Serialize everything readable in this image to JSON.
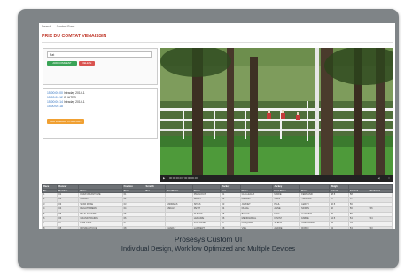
{
  "nav": {
    "items": [
      "Search",
      "Contact Form"
    ]
  },
  "page_title": "PRIX DU COMTAT VENAISSIN",
  "filter": {
    "input_value": "Fat"
  },
  "buttons": {
    "add_comment": "ADD COMMENT",
    "delete": "DELETE",
    "add_remark": "ADD REMARK TO REPORT"
  },
  "log": {
    "entries": [
      {
        "time": "15:00:00.00",
        "text": "Intraday 2014-1"
      },
      {
        "time": "15:00:00.12",
        "text": "CHUTES"
      },
      {
        "time": "15:00:00.14",
        "text": "Intraday 2014-1"
      },
      {
        "time": "15:00:00.18",
        "text": ""
      }
    ]
  },
  "video": {
    "time_label": "00:00:00.00 / 00:00:00.00"
  },
  "table": {
    "group_headers": [
      "Race",
      "Runner",
      "",
      "Fraction",
      "Scratch",
      "",
      "",
      "Jockey",
      "",
      "Jockey",
      "",
      "Weight",
      "",
      ""
    ],
    "headers": [
      "No",
      "Number",
      "Name",
      "Start",
      "Pos",
      "First Name",
      "Name",
      "Hat",
      "Name",
      "First Name",
      "Name",
      "Actual",
      "Carried",
      "Declared"
    ],
    "rows": [
      [
        "1",
        "01",
        "KADAYA FANTOME",
        "01",
        "",
        "",
        "PIERLOUIS",
        "01",
        "GUILLEAUX",
        "MARIE",
        "FERNAND",
        "58.5",
        "58",
        ""
      ],
      [
        "2",
        "02",
        "CALMO",
        "02",
        "",
        "",
        "BAILLY",
        "02",
        "PERRIN",
        "JEAN",
        "THOMAS",
        "57",
        "57",
        ""
      ],
      [
        "3",
        "03",
        "STAR ROSE",
        "03",
        "",
        "ANDREAS",
        "SPIES",
        "03",
        "JARNET",
        "PAUL",
        "LEROY",
        "56.5",
        "56",
        ""
      ],
      [
        "4",
        "04",
        "REGATTABERG",
        "04",
        "",
        "ASDALT",
        "PETIT",
        "04",
        "DUVAL",
        "ANNE",
        "MORIN",
        "56",
        "56",
        "56"
      ],
      [
        "5",
        "05",
        "BLUE DANUBE",
        "05",
        "",
        "",
        "DUBOIS",
        "05",
        "BOEUF",
        "ERIC",
        "GARNIER",
        "55",
        "55",
        ""
      ],
      [
        "6",
        "06",
        "GRAND PRAIRIE",
        "06",
        "",
        "",
        "LEMAIRE",
        "06",
        "MENDIZABAL",
        "IONITZ",
        "FABRE",
        "54.5",
        "54",
        "54"
      ],
      [
        "7",
        "07",
        "FIRE KING",
        "07",
        "",
        "",
        "FONTAINE",
        "07",
        "PASQUIER",
        "STEPH",
        "CHEVALIER",
        "54",
        "54",
        ""
      ],
      [
        "8",
        "08",
        "ROSMANTIQUE",
        "08",
        "",
        "CHARLY",
        "LAMBERT",
        "08",
        "VIEL",
        "ANDRE",
        "ROBIN",
        "53",
        "53",
        "53"
      ]
    ]
  },
  "caption": {
    "line1": "Prosesys Custom UI",
    "line2": "Individual Design, Workflow Optimized and Multiple Devices"
  },
  "colors": {
    "frame": "#7f8487",
    "title_red": "#c0392b",
    "button_green": "#3aa457",
    "button_red": "#d9534f",
    "button_orange": "#f0a032",
    "table_header": "#6d7175"
  },
  "icons": {
    "play": "play-icon",
    "volume": "volume-icon",
    "fullscreen": "fullscreen-icon"
  }
}
